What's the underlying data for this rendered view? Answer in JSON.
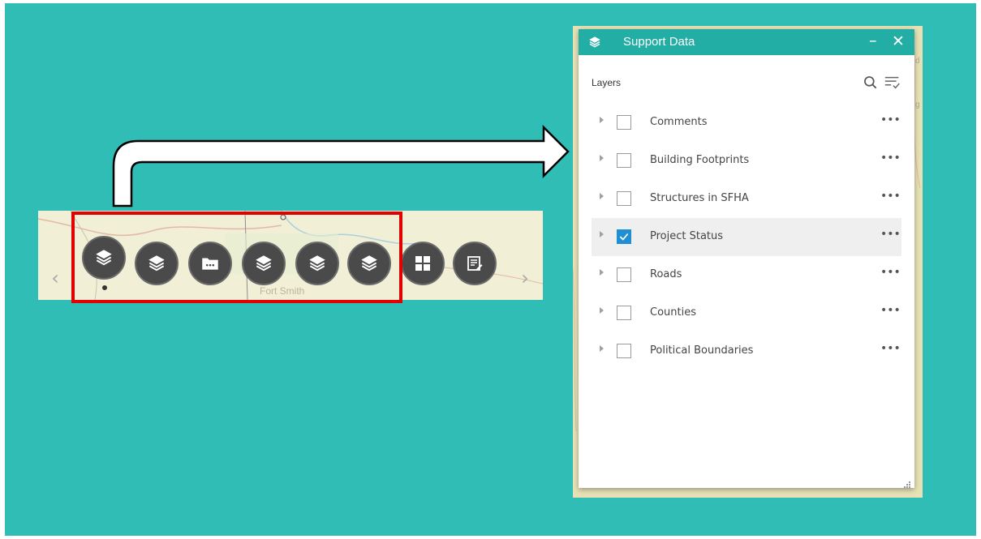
{
  "map": {
    "label": "Fort Smith",
    "nav_prev_icon": "chevron-left-icon",
    "nav_next_icon": "chevron-right-icon"
  },
  "toolbar": {
    "buttons": [
      {
        "icon": "layers-icon",
        "active": true
      },
      {
        "icon": "layers-icon"
      },
      {
        "icon": "folder-more-icon"
      },
      {
        "icon": "layers-icon"
      },
      {
        "icon": "layers-icon"
      },
      {
        "icon": "layers-icon"
      },
      {
        "icon": "grid-icon"
      },
      {
        "icon": "edit-list-icon"
      }
    ],
    "highlight_color": "#e30000"
  },
  "panel": {
    "title": "Support Data",
    "header_color": "#22aea5",
    "minimize_label": "–",
    "close_label": "✕",
    "section_label": "Layers",
    "more_label": "•••",
    "layers": [
      {
        "name": "Comments",
        "checked": false
      },
      {
        "name": "Building Footprints",
        "checked": false
      },
      {
        "name": "Structures in SFHA",
        "checked": false
      },
      {
        "name": "Project Status",
        "checked": true
      },
      {
        "name": "Roads",
        "checked": false
      },
      {
        "name": "Counties",
        "checked": false
      },
      {
        "name": "Political Boundaries",
        "checked": false
      }
    ],
    "checkbox_color": "#1f8ed3"
  }
}
